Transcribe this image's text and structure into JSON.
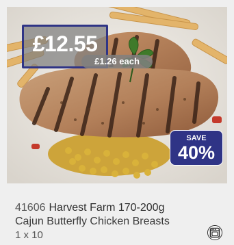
{
  "product": {
    "price": "£12.55",
    "price_each": "£1.26 each",
    "save_label": "SAVE",
    "save_percent": "40%",
    "code": "41606",
    "name_line1": "Harvest Farm 170-200g",
    "name_line2": "Cajun Butterfly Chicken Breasts",
    "pack_size": "1 x 10",
    "cooking_icon": "oven-icon",
    "image_icon": "grilled-chicken-image"
  },
  "colors": {
    "brand_navy": "#2f3486",
    "price_overlay": "#808080",
    "background": "#efefef"
  }
}
